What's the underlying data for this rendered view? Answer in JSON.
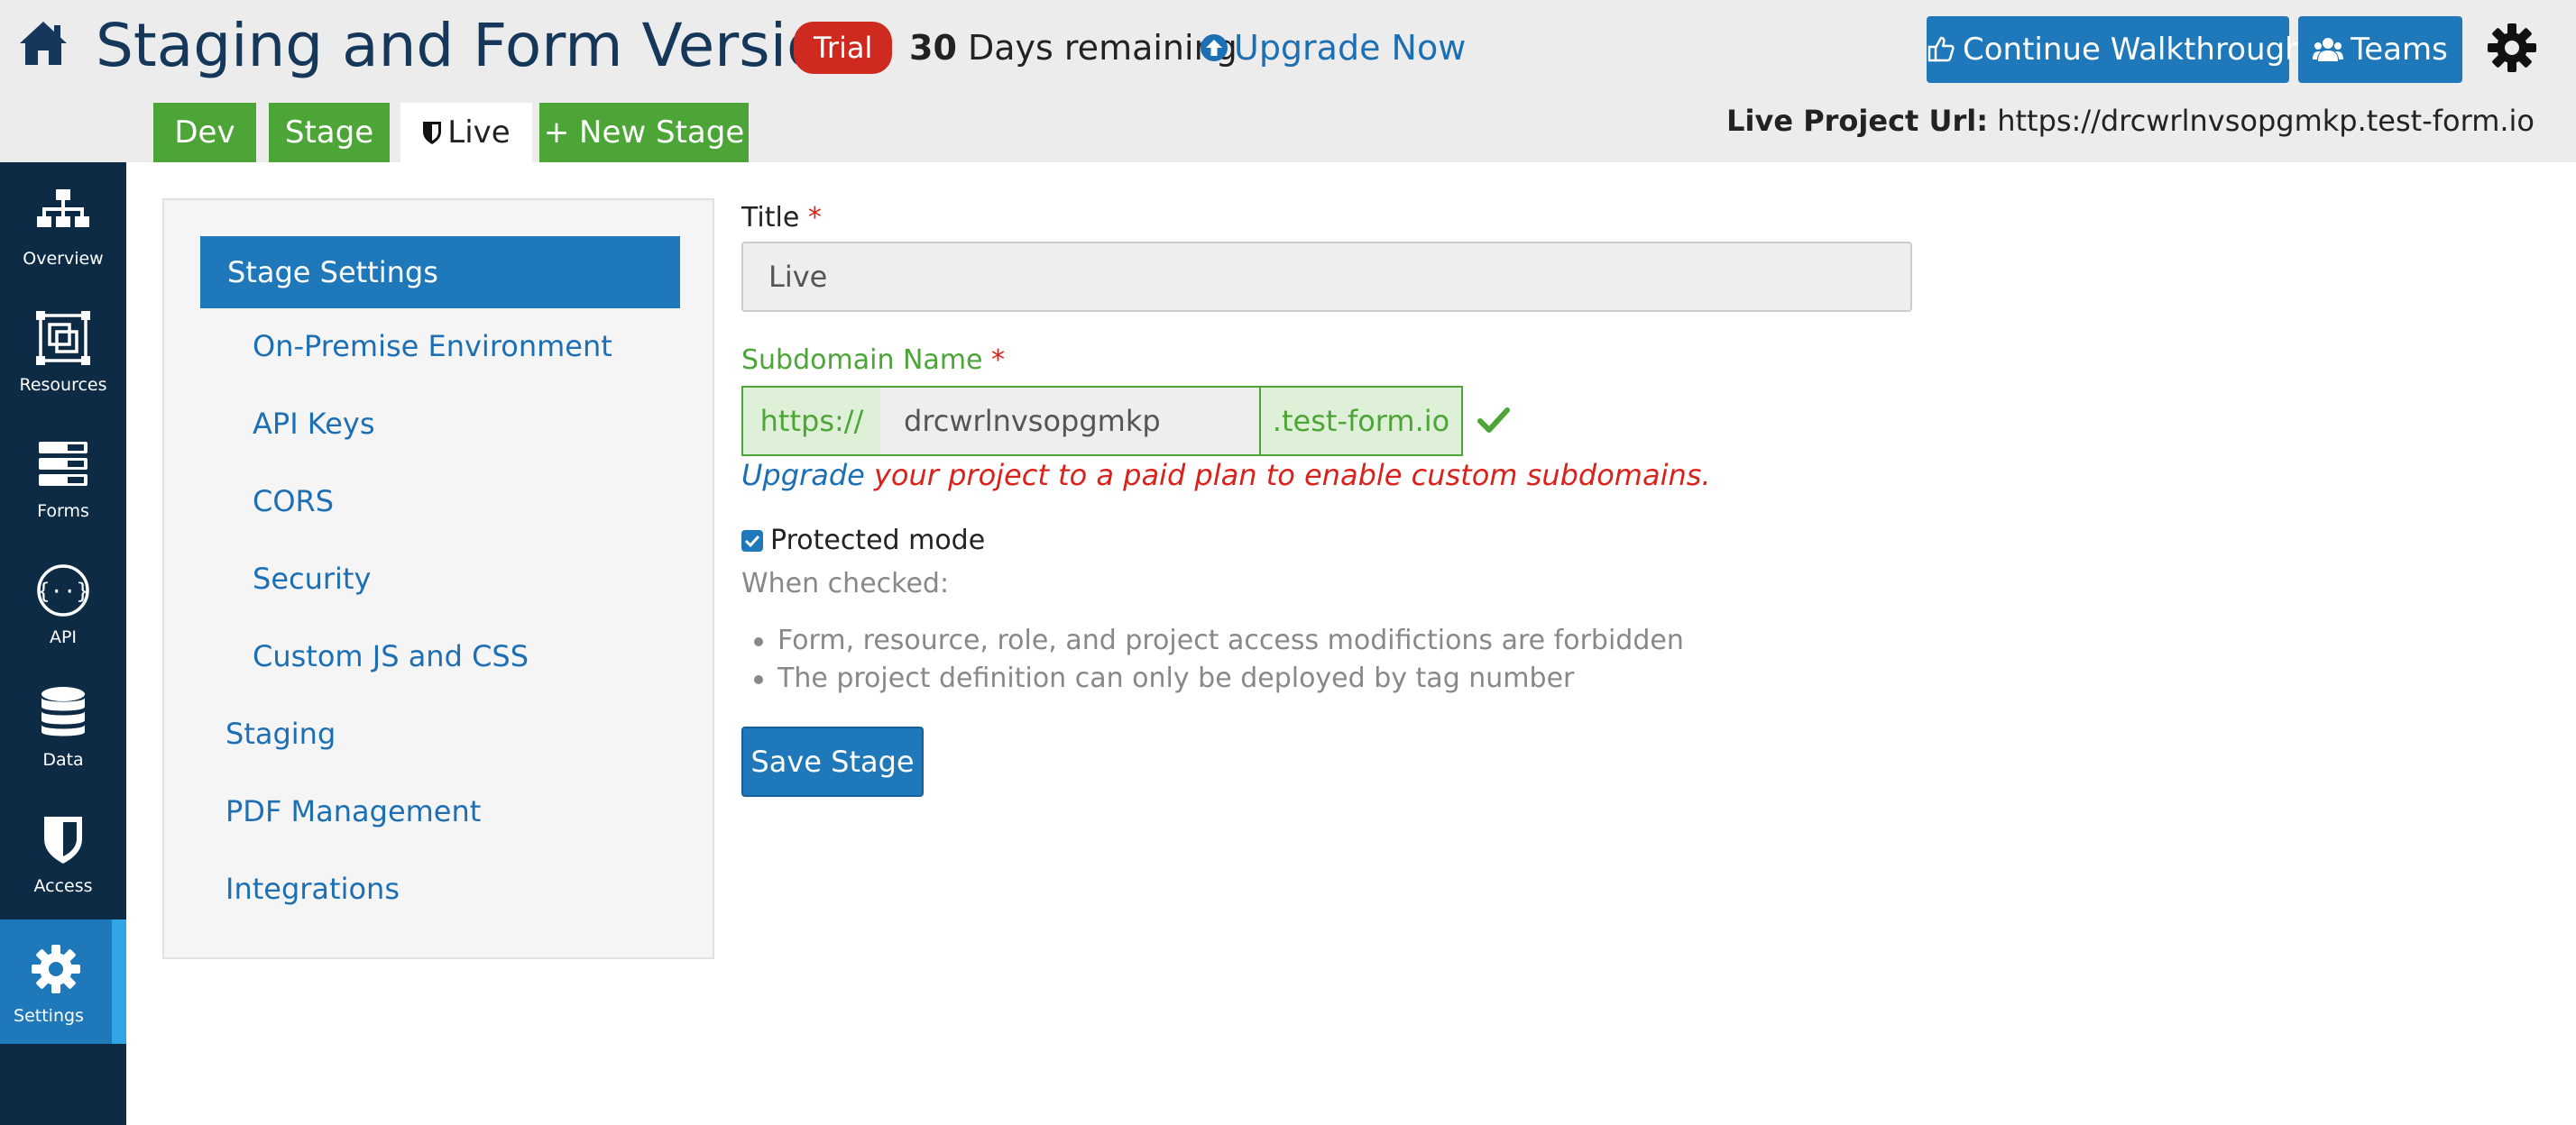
{
  "header": {
    "title": "Staging and Form Versions",
    "trial_badge": "Trial",
    "days_count": "30",
    "days_text": "Days remaining",
    "upgrade_link": "Upgrade Now",
    "walkthrough_button": "Continue Walkthrough",
    "teams_button": "Teams",
    "live_url_label": "Live Project Url:",
    "live_url_value": "https://drcwrlnvsopgmkp.test-form.io"
  },
  "tabs": [
    {
      "label": "Dev"
    },
    {
      "label": "Stage"
    },
    {
      "label": "Live"
    },
    {
      "label": "+ New Stage"
    }
  ],
  "leftnav": {
    "items": [
      {
        "label": "Overview",
        "icon": "sitemap-icon"
      },
      {
        "label": "Resources",
        "icon": "resources-icon"
      },
      {
        "label": "Forms",
        "icon": "forms-icon"
      },
      {
        "label": "API",
        "icon": "api-icon"
      },
      {
        "label": "Data",
        "icon": "database-icon"
      },
      {
        "label": "Access",
        "icon": "shield-icon"
      },
      {
        "label": "Settings",
        "icon": "gear-icon",
        "active": true
      }
    ]
  },
  "settings_menu": {
    "active": "Stage Settings",
    "subitems": [
      "On-Premise Environment",
      "API Keys",
      "CORS",
      "Security",
      "Custom JS and CSS"
    ],
    "items": [
      "Staging",
      "PDF Management",
      "Integrations"
    ]
  },
  "form": {
    "title_label": "Title",
    "required_mark": "*",
    "title_value": "Live",
    "subdomain_label": "Subdomain Name",
    "subdomain_prefix": "https://",
    "subdomain_value": "drcwrlnvsopgmkp",
    "subdomain_suffix": ".test-form.io",
    "upgrade_link": "Upgrade",
    "upgrade_text": " your project to a paid plan to enable custom subdomains.",
    "protected_mode_label": "Protected mode",
    "protected_mode_checked": true,
    "when_checked_label": "When checked:",
    "bullets": [
      "Form, resource, role, and project access modifictions are forbidden",
      "The project definition can only be deployed by tag number"
    ],
    "save_button": "Save Stage"
  },
  "colors": {
    "brand_blue": "#1e78b9",
    "nav_bg": "#0e2b46",
    "stage_green": "#4ca536",
    "trial_red": "#cf2a1f"
  }
}
